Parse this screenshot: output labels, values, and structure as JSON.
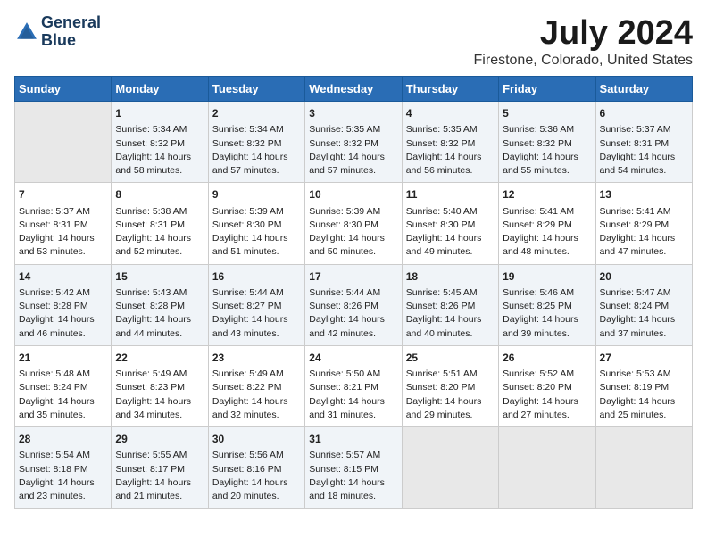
{
  "header": {
    "logo_line1": "General",
    "logo_line2": "Blue",
    "main_title": "July 2024",
    "subtitle": "Firestone, Colorado, United States"
  },
  "calendar": {
    "days_of_week": [
      "Sunday",
      "Monday",
      "Tuesday",
      "Wednesday",
      "Thursday",
      "Friday",
      "Saturday"
    ],
    "weeks": [
      [
        {
          "day": "",
          "content": ""
        },
        {
          "day": "1",
          "content": "Sunrise: 5:34 AM\nSunset: 8:32 PM\nDaylight: 14 hours\nand 58 minutes."
        },
        {
          "day": "2",
          "content": "Sunrise: 5:34 AM\nSunset: 8:32 PM\nDaylight: 14 hours\nand 57 minutes."
        },
        {
          "day": "3",
          "content": "Sunrise: 5:35 AM\nSunset: 8:32 PM\nDaylight: 14 hours\nand 57 minutes."
        },
        {
          "day": "4",
          "content": "Sunrise: 5:35 AM\nSunset: 8:32 PM\nDaylight: 14 hours\nand 56 minutes."
        },
        {
          "day": "5",
          "content": "Sunrise: 5:36 AM\nSunset: 8:32 PM\nDaylight: 14 hours\nand 55 minutes."
        },
        {
          "day": "6",
          "content": "Sunrise: 5:37 AM\nSunset: 8:31 PM\nDaylight: 14 hours\nand 54 minutes."
        }
      ],
      [
        {
          "day": "7",
          "content": "Sunrise: 5:37 AM\nSunset: 8:31 PM\nDaylight: 14 hours\nand 53 minutes."
        },
        {
          "day": "8",
          "content": "Sunrise: 5:38 AM\nSunset: 8:31 PM\nDaylight: 14 hours\nand 52 minutes."
        },
        {
          "day": "9",
          "content": "Sunrise: 5:39 AM\nSunset: 8:30 PM\nDaylight: 14 hours\nand 51 minutes."
        },
        {
          "day": "10",
          "content": "Sunrise: 5:39 AM\nSunset: 8:30 PM\nDaylight: 14 hours\nand 50 minutes."
        },
        {
          "day": "11",
          "content": "Sunrise: 5:40 AM\nSunset: 8:30 PM\nDaylight: 14 hours\nand 49 minutes."
        },
        {
          "day": "12",
          "content": "Sunrise: 5:41 AM\nSunset: 8:29 PM\nDaylight: 14 hours\nand 48 minutes."
        },
        {
          "day": "13",
          "content": "Sunrise: 5:41 AM\nSunset: 8:29 PM\nDaylight: 14 hours\nand 47 minutes."
        }
      ],
      [
        {
          "day": "14",
          "content": "Sunrise: 5:42 AM\nSunset: 8:28 PM\nDaylight: 14 hours\nand 46 minutes."
        },
        {
          "day": "15",
          "content": "Sunrise: 5:43 AM\nSunset: 8:28 PM\nDaylight: 14 hours\nand 44 minutes."
        },
        {
          "day": "16",
          "content": "Sunrise: 5:44 AM\nSunset: 8:27 PM\nDaylight: 14 hours\nand 43 minutes."
        },
        {
          "day": "17",
          "content": "Sunrise: 5:44 AM\nSunset: 8:26 PM\nDaylight: 14 hours\nand 42 minutes."
        },
        {
          "day": "18",
          "content": "Sunrise: 5:45 AM\nSunset: 8:26 PM\nDaylight: 14 hours\nand 40 minutes."
        },
        {
          "day": "19",
          "content": "Sunrise: 5:46 AM\nSunset: 8:25 PM\nDaylight: 14 hours\nand 39 minutes."
        },
        {
          "day": "20",
          "content": "Sunrise: 5:47 AM\nSunset: 8:24 PM\nDaylight: 14 hours\nand 37 minutes."
        }
      ],
      [
        {
          "day": "21",
          "content": "Sunrise: 5:48 AM\nSunset: 8:24 PM\nDaylight: 14 hours\nand 35 minutes."
        },
        {
          "day": "22",
          "content": "Sunrise: 5:49 AM\nSunset: 8:23 PM\nDaylight: 14 hours\nand 34 minutes."
        },
        {
          "day": "23",
          "content": "Sunrise: 5:49 AM\nSunset: 8:22 PM\nDaylight: 14 hours\nand 32 minutes."
        },
        {
          "day": "24",
          "content": "Sunrise: 5:50 AM\nSunset: 8:21 PM\nDaylight: 14 hours\nand 31 minutes."
        },
        {
          "day": "25",
          "content": "Sunrise: 5:51 AM\nSunset: 8:20 PM\nDaylight: 14 hours\nand 29 minutes."
        },
        {
          "day": "26",
          "content": "Sunrise: 5:52 AM\nSunset: 8:20 PM\nDaylight: 14 hours\nand 27 minutes."
        },
        {
          "day": "27",
          "content": "Sunrise: 5:53 AM\nSunset: 8:19 PM\nDaylight: 14 hours\nand 25 minutes."
        }
      ],
      [
        {
          "day": "28",
          "content": "Sunrise: 5:54 AM\nSunset: 8:18 PM\nDaylight: 14 hours\nand 23 minutes."
        },
        {
          "day": "29",
          "content": "Sunrise: 5:55 AM\nSunset: 8:17 PM\nDaylight: 14 hours\nand 21 minutes."
        },
        {
          "day": "30",
          "content": "Sunrise: 5:56 AM\nSunset: 8:16 PM\nDaylight: 14 hours\nand 20 minutes."
        },
        {
          "day": "31",
          "content": "Sunrise: 5:57 AM\nSunset: 8:15 PM\nDaylight: 14 hours\nand 18 minutes."
        },
        {
          "day": "",
          "content": ""
        },
        {
          "day": "",
          "content": ""
        },
        {
          "day": "",
          "content": ""
        }
      ]
    ]
  }
}
